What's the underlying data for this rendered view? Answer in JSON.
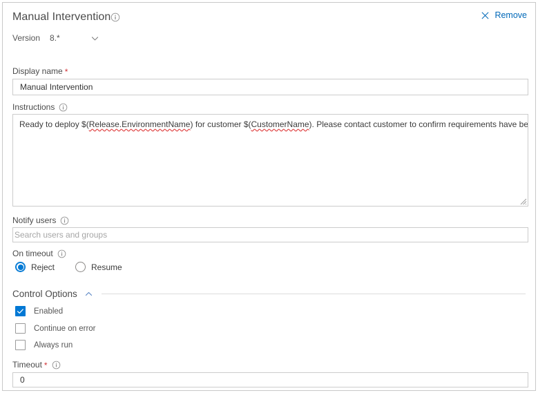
{
  "header": {
    "task_title": "Manual Intervention",
    "title_info_icon": "info-icon",
    "remove_label": "Remove",
    "remove_icon": "close-icon",
    "accent_color": "#0068b8"
  },
  "version": {
    "label": "Version",
    "value": "8.*",
    "chevron_icon": "chevron-down-icon"
  },
  "display_name": {
    "label": "Display name",
    "required": "*",
    "value": "Manual Intervention"
  },
  "instructions": {
    "label": "Instructions",
    "info_icon": "info-icon",
    "segments": [
      {
        "text": "Ready to deploy $(",
        "spell_error": false
      },
      {
        "text": "Release.EnvironmentName",
        "spell_error": true
      },
      {
        "text": ") for customer $(",
        "spell_error": false
      },
      {
        "text": "CustomerName",
        "spell_error": true
      },
      {
        "text": "). Please contact customer to confirm requirements have been met.",
        "spell_error": false
      }
    ],
    "full_text": "Ready to deploy $(Release.EnvironmentName) for customer $(CustomerName). Please contact customer to confirm requirements have been met.",
    "resize_grip": "resize-grip-icon"
  },
  "notify_users": {
    "label": "Notify users",
    "info_icon": "info-icon",
    "value": "",
    "placeholder": "Search users and groups"
  },
  "on_timeout": {
    "label": "On timeout",
    "info_icon": "info-icon",
    "options": [
      {
        "label": "Reject",
        "checked": true
      },
      {
        "label": "Resume",
        "checked": false
      }
    ]
  },
  "control_options": {
    "title": "Control Options",
    "chevron_icon": "chevron-up-icon",
    "expanded": true,
    "checkboxes": [
      {
        "label": "Enabled",
        "checked": true
      },
      {
        "label": "Continue on error",
        "checked": false
      },
      {
        "label": "Always run",
        "checked": false
      }
    ]
  },
  "timeout": {
    "label": "Timeout",
    "required": "*",
    "info_icon": "info-icon",
    "value": "0"
  },
  "colors": {
    "accent": "#0078d4",
    "link": "#0068b8",
    "required_star": "#d13438",
    "border": "#cccccc",
    "panel_border": "#c8c8c8",
    "spell_underline": "#e04a4a"
  }
}
